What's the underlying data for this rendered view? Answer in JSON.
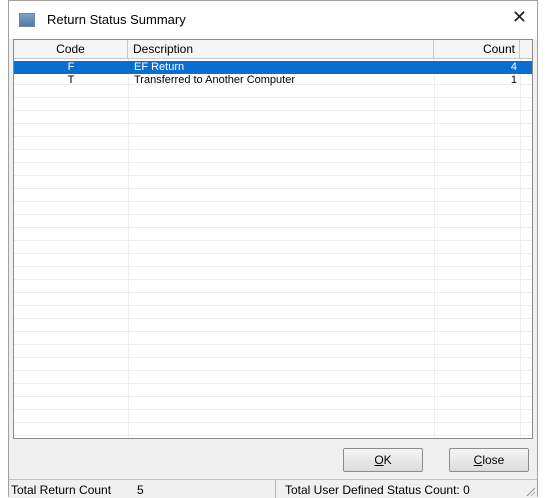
{
  "window": {
    "title": "Return Status Summary",
    "close_glyph": "✕"
  },
  "columns": {
    "code": "Code",
    "description": "Description",
    "count": "Count"
  },
  "rows": [
    {
      "code": "F",
      "description": "EF Return",
      "count": "4",
      "selected": true
    },
    {
      "code": "T",
      "description": "Transferred to Another Computer",
      "count": "1",
      "selected": false
    }
  ],
  "buttons": {
    "ok_prefix": "O",
    "ok_rest": "K",
    "close_prefix": "C",
    "close_rest": "lose"
  },
  "status": {
    "total_return_label": "Total Return Count",
    "total_return_value": "5",
    "user_defined_label": "Total User Defined Status Count: 0"
  },
  "colors": {
    "selection": "#0a6ed1"
  },
  "icons": {
    "app": "app-window-icon",
    "close": "close-icon",
    "grip": "resize-grip-icon"
  }
}
